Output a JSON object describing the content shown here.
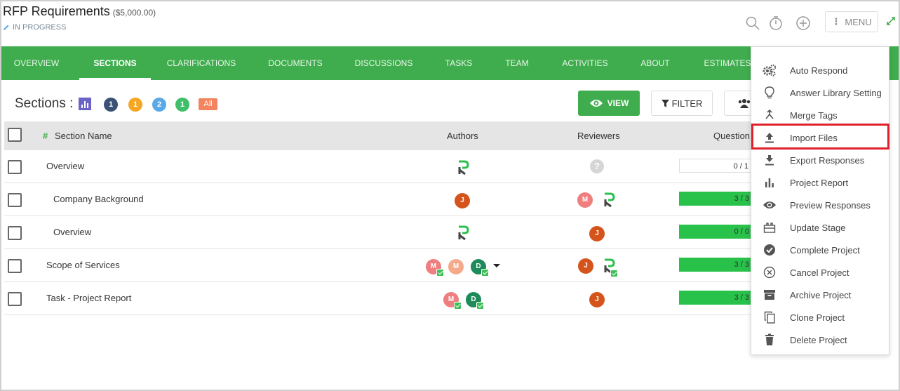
{
  "header": {
    "title": "RFP Requirements",
    "amount": "($5,000.00)",
    "status": "IN PROGRESS",
    "menu_label": "MENU",
    "icons": [
      "search-icon",
      "timer-icon",
      "add-circle-icon",
      "expand-icon"
    ]
  },
  "nav": {
    "tabs": [
      {
        "label": "OVERVIEW"
      },
      {
        "label": "SECTIONS",
        "active": true
      },
      {
        "label": "CLARIFICATIONS"
      },
      {
        "label": "DOCUMENTS"
      },
      {
        "label": "DISCUSSIONS"
      },
      {
        "label": "TASKS"
      },
      {
        "label": "TEAM"
      },
      {
        "label": "ACTIVITIES"
      },
      {
        "label": "ABOUT"
      },
      {
        "label": "ESTIMATES"
      }
    ]
  },
  "toolbar": {
    "sections_label": "Sections :",
    "badges": [
      {
        "value": "1",
        "color": "#3b5275"
      },
      {
        "value": "1",
        "color": "#f5a623"
      },
      {
        "value": "2",
        "color": "#5aa9e6"
      },
      {
        "value": "1",
        "color": "#3fbf6a"
      }
    ],
    "all_label": "All",
    "view_label": "VIEW",
    "filter_label": "FILTER"
  },
  "table": {
    "headers": {
      "hash": "#",
      "section_name": "Section Name",
      "authors": "Authors",
      "reviewers": "Reviewers",
      "questions": "Question"
    },
    "rows": [
      {
        "name": "Overview",
        "questions": "0 / 1"
      },
      {
        "name": "Company Background",
        "questions": "3 / 3"
      },
      {
        "name": "Overview",
        "questions": "0 / 0"
      },
      {
        "name": "Scope of Services",
        "questions": "3 / 3"
      },
      {
        "name": "Task - Project Report",
        "questions": "3 / 3"
      }
    ],
    "avatar_initials": {
      "j": "J",
      "m": "M",
      "d": "D"
    },
    "help_glyph": "?"
  },
  "menu": {
    "items": [
      {
        "label": "Auto Respond",
        "icon": "gears-icon"
      },
      {
        "label": "Answer Library Setting",
        "icon": "lightbulb-icon"
      },
      {
        "label": "Merge Tags",
        "icon": "merge-icon"
      },
      {
        "label": "Import Files",
        "icon": "upload-icon",
        "highlighted": true
      },
      {
        "label": "Export Responses",
        "icon": "download-icon"
      },
      {
        "label": "Project Report",
        "icon": "bar-chart-icon"
      },
      {
        "label": "Preview Responses",
        "icon": "eye-icon"
      },
      {
        "label": "Update Stage",
        "icon": "stage-icon"
      },
      {
        "label": "Complete Project",
        "icon": "check-circle-icon"
      },
      {
        "label": "Cancel Project",
        "icon": "cancel-circle-icon"
      },
      {
        "label": "Archive Project",
        "icon": "archive-icon"
      },
      {
        "label": "Clone Project",
        "icon": "copy-icon"
      },
      {
        "label": "Delete Project",
        "icon": "trash-icon"
      }
    ]
  },
  "colors": {
    "brand_green": "#3fad4d",
    "progress_green": "#28c24a",
    "highlight_red": "#e0202a"
  }
}
